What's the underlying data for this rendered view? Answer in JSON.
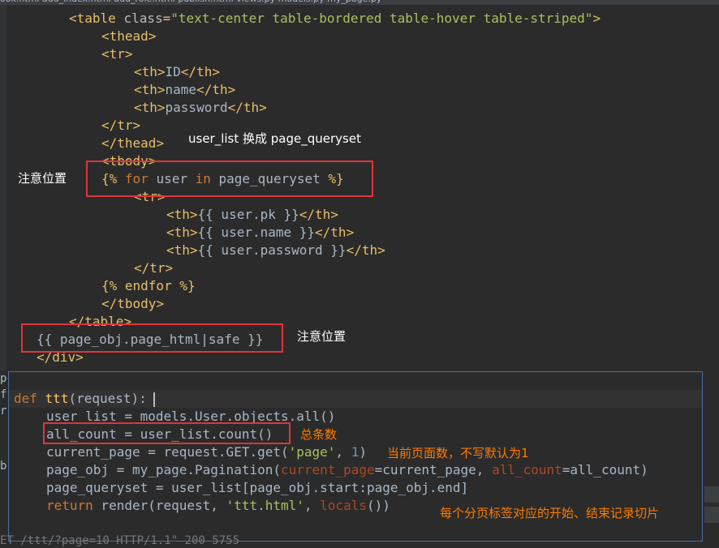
{
  "template_code": {
    "table_open": {
      "tag": "table",
      "attr": "class",
      "value": "\"text-center table-bordered table-hover table-striped\""
    },
    "thead_open": "thead",
    "tr_open": "tr",
    "th_id": "ID",
    "th_name": "name",
    "th_password": "password",
    "tr_close": "tr",
    "thead_close": "thead",
    "tbody_open": "tbody",
    "for_loop": {
      "open": "{% ",
      "kw_for": "for",
      "var": " user ",
      "kw_in": "in",
      "iter": " page_queryset ",
      "close": "%}"
    },
    "tr2_open": "tr",
    "cell_pk": "{{ user.pk }}",
    "cell_name": "{{ user.name }}",
    "cell_password": "{{ user.password }}",
    "tr2_close": "tr",
    "endfor": "{% endfor %}",
    "tbody_close": "tbody",
    "table_close": "table",
    "page_html": "{{ page_obj.page_html|safe }}",
    "div_close": "div"
  },
  "view_code": {
    "def_kw": "def",
    "func_name": "ttt",
    "def_params": "(request):",
    "line_user_list": "user_list = models.User.objects.all()",
    "line_all_count": "all_count = user_list.count()",
    "line_current_page": {
      "prefix": "current_page = request.GET.get(",
      "str": "'page'",
      "middle": ", ",
      "num": "1",
      "suffix": ")"
    },
    "line_page_obj": {
      "prefix": "page_obj = my_page.Pagination(",
      "arg1": "current_page",
      "eq1": "=current_page, ",
      "arg2": "all_count",
      "eq2": "=all_count)"
    },
    "line_queryset": "page_queryset = user_list[page_obj.start:page_obj.end]",
    "line_return": {
      "kw": "return",
      "prefix": " render(request, ",
      "str": "'ttt.html'",
      "middle": ", ",
      "named": "locals",
      "suffix": "())"
    }
  },
  "annotations": {
    "replace_note": "user_list 换成 page_queryset",
    "attention_left": "注意位置",
    "attention_right": "注意位置",
    "total_count": "总条数",
    "current_page_note": "当前页面数，不写默认为1",
    "slice_note": "每个分页标签对应的开始、结束记录切片"
  },
  "background_fragments": {
    "bottom_log": "ET /ttt/?page=10 HTTP/1.1\" 200 5755"
  },
  "colors": {
    "editor_bg": "#2b2b2b",
    "tag": "#e8bf6a",
    "keyword": "#cc7832",
    "string": "#a5c261",
    "highlight_box": "#e0343a",
    "annotation_orange": "#ff7a00"
  }
}
